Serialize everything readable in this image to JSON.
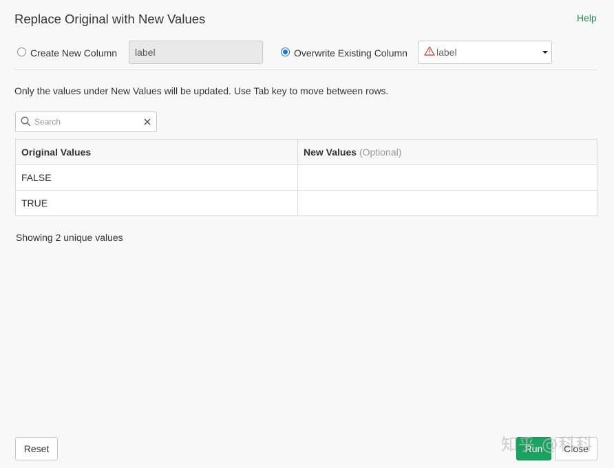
{
  "dialog": {
    "title": "Replace Original with New Values",
    "help_label": "Help"
  },
  "options": {
    "create_new_label": "Create New Column",
    "create_new_selected": false,
    "new_column_value": "label",
    "overwrite_label": "Overwrite Existing Column",
    "overwrite_selected": true,
    "existing_column_selected": "label",
    "warning_icon": "warning-triangle-icon"
  },
  "info_text": "Only the values under New Values will be updated. Use Tab key to move between rows.",
  "search": {
    "placeholder": "Search",
    "value": ""
  },
  "table": {
    "headers": {
      "original": "Original Values",
      "new": "New Values",
      "new_hint": "(Optional)"
    },
    "rows": [
      {
        "original": "FALSE",
        "new": ""
      },
      {
        "original": "TRUE",
        "new": ""
      }
    ]
  },
  "summary_text": "Showing 2 unique values",
  "buttons": {
    "reset": "Reset",
    "run": "Run",
    "close": "Close"
  },
  "colors": {
    "accent_green": "#1aa260",
    "help_link": "#2e8b57",
    "radio_selected": "#1e74d9",
    "warning_red": "#d9534f"
  },
  "watermark": "知乎 @科科"
}
